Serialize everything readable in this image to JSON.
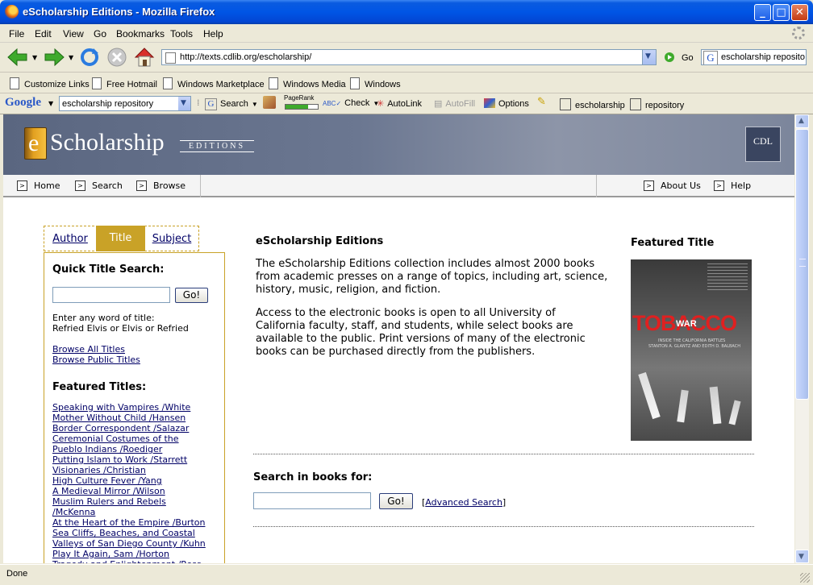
{
  "window": {
    "title": "eScholarship Editions - Mozilla Firefox"
  },
  "menu": [
    "File",
    "Edit",
    "View",
    "Go",
    "Bookmarks",
    "Tools",
    "Help"
  ],
  "nav": {
    "url": "http://texts.cdlib.org/escholarship/",
    "go_label": "Go",
    "search_value": "escholarship reposito"
  },
  "links_bar": [
    "Customize Links",
    "Free Hotmail",
    "Windows Marketplace",
    "Windows Media",
    "Windows"
  ],
  "google_bar": {
    "logo": "Google",
    "search_value": "escholarship repository",
    "search_label": "Search",
    "pagerank_label": "PageRank",
    "check_label": "Check",
    "autolink_label": "AutoLink",
    "autofill_label": "AutoFill",
    "options_label": "Options",
    "term1": "escholarship",
    "term2": "repository"
  },
  "site": {
    "logo_e": "e",
    "logo_text": "Scholarship",
    "logo_sub": "EDITIONS",
    "cdl_badge": "CDL",
    "nav_left": [
      "Home",
      "Search",
      "Browse"
    ],
    "nav_right": [
      "About Us",
      "Help"
    ]
  },
  "sidebar": {
    "tabs": [
      "Author",
      "Title",
      "Subject"
    ],
    "quick_heading": "Quick Title Search:",
    "go_label": "Go!",
    "hint_line1": "Enter any word of title:",
    "hint_line2": "Refried Elvis or Elvis or Refried",
    "browse_all": "Browse All Titles",
    "browse_public": "Browse Public Titles",
    "featured_heading": "Featured Titles:",
    "featured": [
      "Speaking with Vampires /White",
      "Mother Without Child /Hansen",
      "Border Correspondent /Salazar",
      "Ceremonial Costumes of the",
      "Pueblo Indians /Roediger",
      "Putting Islam to Work /Starrett",
      "Visionaries /Christian",
      "High Culture Fever /Yang",
      "A Medieval Mirror /Wilson",
      "Muslim Rulers and Rebels",
      "/McKenna",
      "At the Heart of the Empire /Burton",
      "Sea Cliffs, Beaches, and Coastal",
      "Valleys of San Diego County /Kuhn",
      "Play It Again, Sam /Horton",
      "Tragedy and Enlightenment /Ross"
    ]
  },
  "main": {
    "heading": "eScholarship Editions",
    "para1": "The eScholarship Editions collection includes almost 2000 books from academic presses on a range of topics, including art, science, history, music, religion, and fiction.",
    "para2": "Access to the electronic books is open to all University of California faculty, staff, and students, while select books are available to the public. Print versions of many of the electronic books can be purchased directly from the publishers.",
    "search_heading": "Search in books for:",
    "go_label": "Go!",
    "advanced_label": "Advanced Search",
    "bracket_open": "[",
    "bracket_close": "]"
  },
  "featured_title": {
    "heading": "Featured Title",
    "cover_title": "TOBACCO",
    "cover_war": "WAR",
    "cover_subtitle": "INSIDE THE CALIFORNIA BATTLES",
    "cover_authors": "STANTON A. GLANTZ AND EDITH D. BALBACH"
  },
  "status": {
    "text": "Done"
  },
  "colors": {
    "accent_tab": "#c9a227",
    "link": "#000066",
    "banner": "#6b7791",
    "cover_red": "#e02020"
  }
}
